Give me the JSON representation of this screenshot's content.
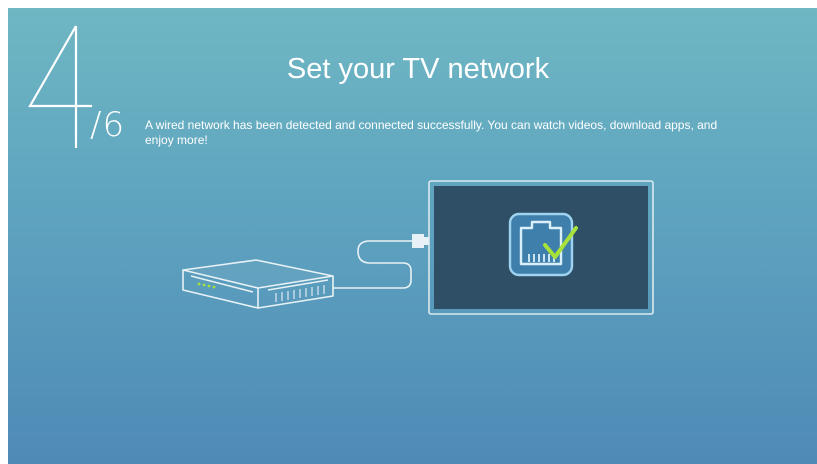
{
  "setup": {
    "step_current": "4",
    "step_total": "/6",
    "title": "Set your TV network",
    "description": "A wired network has been detected and connected successfully. You can watch videos, download apps, and enjoy more!"
  },
  "icons": {
    "router": "router-icon",
    "cable": "ethernet-cable-icon",
    "tv": "tv-icon",
    "status": "ethernet-connected-check-icon"
  },
  "colors": {
    "background_top": "#6fb7c3",
    "background_bottom": "#4f8ab6",
    "tv_screen": "#2e4f66",
    "check_mark": "#a7e13a"
  }
}
